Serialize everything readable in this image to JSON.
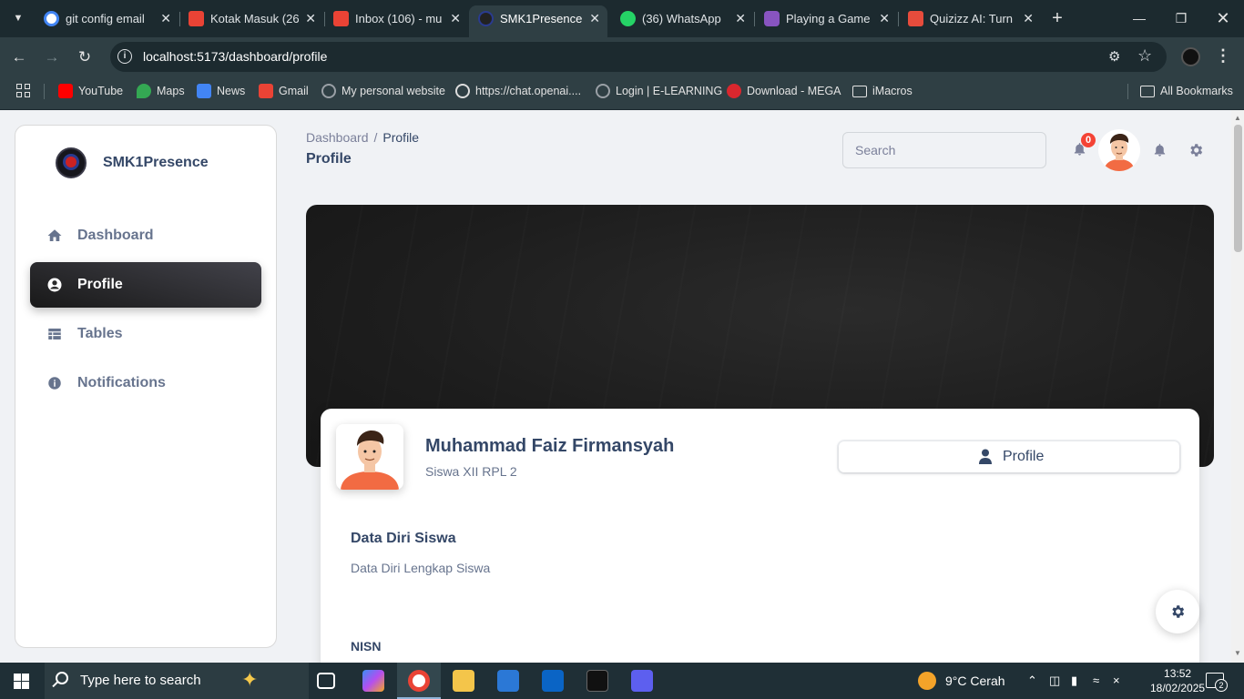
{
  "browser": {
    "tabs": [
      {
        "title": "git config email",
        "favicon": "google-icon",
        "color": "#4285f4"
      },
      {
        "title": "Kotak Masuk (26",
        "favicon": "gmail-icon",
        "color": "#ea4335"
      },
      {
        "title": "Inbox (106) - mu",
        "favicon": "gmail-icon",
        "color": "#ea4335"
      },
      {
        "title": "SMK1Presence",
        "favicon": "smk1-logo-icon",
        "color": "#2a3b8f",
        "active": true
      },
      {
        "title": "(36) WhatsApp",
        "favicon": "whatsapp-icon",
        "color": "#25d366"
      },
      {
        "title": "Playing a Game",
        "favicon": "quizizz-icon",
        "color": "#8854c0"
      },
      {
        "title": "Quizizz AI: Turn",
        "favicon": "quizizz-ai-icon",
        "color": "#e74c3c"
      }
    ],
    "url": "localhost:5173/dashboard/profile",
    "bookmarks": [
      {
        "label": "YouTube",
        "icon": "youtube-icon",
        "color": "#ff0000"
      },
      {
        "label": "Maps",
        "icon": "maps-icon",
        "color": "#34a853"
      },
      {
        "label": "News",
        "icon": "news-icon",
        "color": "#4285f4"
      },
      {
        "label": "Gmail",
        "icon": "gmail-icon",
        "color": "#ea4335"
      },
      {
        "label": "My personal website",
        "icon": "globe-icon",
        "color": "#9aa0a6"
      },
      {
        "label": "https://chat.openai....",
        "icon": "openai-icon",
        "color": "#dddddd"
      },
      {
        "label": "Login | E-LEARNING",
        "icon": "globe-icon",
        "color": "#9aa0a6"
      },
      {
        "label": "Download - MEGA",
        "icon": "mega-icon",
        "color": "#d9272e"
      },
      {
        "label": "iMacros",
        "icon": "folder-icon",
        "color": "#e3e3e3"
      }
    ],
    "all_bookmarks": "All Bookmarks"
  },
  "sidebar": {
    "brand": "SMK1Presence",
    "items": [
      {
        "label": "Dashboard",
        "icon": "home-icon"
      },
      {
        "label": "Profile",
        "icon": "account-circle-icon",
        "active": true
      },
      {
        "label": "Tables",
        "icon": "table-icon"
      },
      {
        "label": "Notifications",
        "icon": "info-icon"
      }
    ]
  },
  "header": {
    "breadcrumb_root": "Dashboard",
    "breadcrumb_sep": "/",
    "breadcrumb_current": "Profile",
    "title": "Profile",
    "search_placeholder": "Search",
    "notification_count": "0"
  },
  "profile": {
    "name": "Muhammad Faiz Firmansyah",
    "class": "Siswa XII RPL 2",
    "tab_label": "Profile",
    "section_title": "Data Diri Siswa",
    "section_subtitle": "Data Diri Lengkap Siswa",
    "field_label": "NISN"
  },
  "taskbar": {
    "search_placeholder": "Type here to search",
    "weather": "9°C  Cerah",
    "time": "13:52",
    "date": "18/02/2025",
    "notifications": "2"
  },
  "colors": {
    "accent_dark": "#191919",
    "text_primary": "#344767",
    "text_secondary": "#67748e",
    "badge": "#f44335"
  }
}
